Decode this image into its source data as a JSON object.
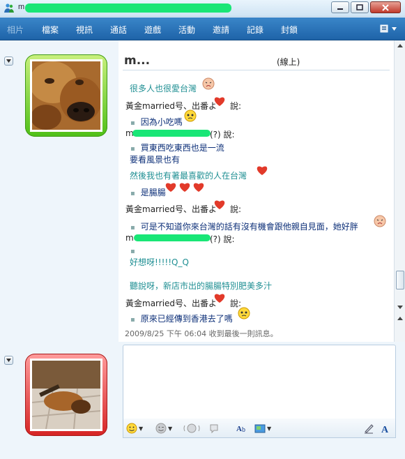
{
  "window": {
    "title": "m",
    "controls": [
      "minimize",
      "maximize",
      "close"
    ]
  },
  "menu": {
    "items": [
      "相片",
      "檔案",
      "視訊",
      "通話",
      "遊戲",
      "活動",
      "邀請",
      "記錄",
      "封鎖"
    ]
  },
  "contact": {
    "name": "m...",
    "status": "(線上)"
  },
  "conversation": {
    "m1": "很多人也很愛台灣",
    "s1": "黃金married号、出番よ",
    "s1_suffix": "說:",
    "m2": "因為小吃嗎",
    "s2_prefix": "m",
    "s2_suffix": "(?) 說:",
    "m3": "買東西吃東西也是一流",
    "m4": "要看風景也有",
    "m5": "然後我也有著最喜歡的人在台灣",
    "m6": "是腸腸",
    "s3": "黃金married号、出番よ",
    "s3_suffix": "說:",
    "m7": "可是不知道你來台灣的話有沒有機會跟他親自見面，她好胖",
    "s4_prefix": "m",
    "s4_suffix": "(?) 說:",
    "m8": "好想呀!!!!!Q_Q",
    "m9": "聽說呀，新店市出的腸腸特別肥美多汁",
    "s5": "黃金married号、出番よ",
    "s5_suffix": "說:",
    "m10": "原來已經傳到香港去了嗎",
    "timestamp": "2009/8/25 下午 06:04 收到最後一則訊息。"
  },
  "toolbar": {
    "icons": [
      "emoticon-icon",
      "wink-icon",
      "nudge-icon",
      "voice-clip-icon",
      "font-icon",
      "background-icon",
      "handwriting-icon",
      "text-icon"
    ]
  },
  "colors": {
    "menu_bg": "#2a73b8",
    "teal_text": "#1f8f93",
    "online_frame": "#4fbf17",
    "self_frame": "#d62424",
    "redaction": "#19e676"
  }
}
